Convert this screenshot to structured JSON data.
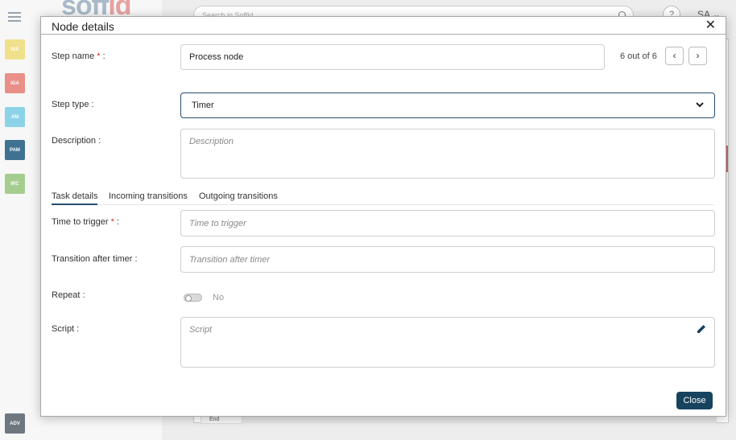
{
  "app": {
    "logo_text": "soffid",
    "search_placeholder": "Search in Soffid",
    "help_label": "?",
    "user_initials": "SA",
    "modules": [
      {
        "label": "ISS",
        "color": "#efe08c"
      },
      {
        "label": "IGA",
        "color": "#e98f88"
      },
      {
        "label": "AM",
        "color": "#8dd3e8"
      },
      {
        "label": "PAM",
        "color": "#3e7290"
      },
      {
        "label": "IRC",
        "color": "#a6cd90"
      }
    ],
    "adv_module": {
      "label": "ADV",
      "color": "#6e7780"
    },
    "end_node_label": "End"
  },
  "dialog": {
    "title": "Node details",
    "step_name": {
      "label": "Step name",
      "required_mark": "*",
      "suffix": " :",
      "value": "Process node"
    },
    "counter": "6 out of 6",
    "step_type": {
      "label": "Step type :",
      "value": "Timer"
    },
    "description": {
      "label": "Description :",
      "placeholder": "Description"
    },
    "tabs": [
      {
        "label": "Task details",
        "active": true
      },
      {
        "label": "Incoming transitions",
        "active": false
      },
      {
        "label": "Outgoing transitions",
        "active": false
      }
    ],
    "time_to_trigger": {
      "label": "Time to trigger",
      "required_mark": "*",
      "suffix": " :",
      "placeholder": "Time to trigger"
    },
    "transition_after_timer": {
      "label": "Transition after timer :",
      "placeholder": "Transition after timer"
    },
    "repeat": {
      "label": "Repeat :",
      "state_label": "No",
      "on": false
    },
    "script": {
      "label": "Script :",
      "placeholder": "Script"
    },
    "close_button": "Close"
  },
  "colors": {
    "primary": "#17435f",
    "accent_border": "#264d6e",
    "required": "#d32f2f"
  }
}
